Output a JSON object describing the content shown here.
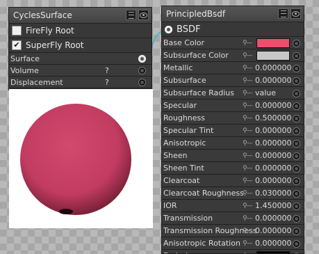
{
  "cycles_node": {
    "title": "CyclesSurface",
    "checks": [
      {
        "label": "FireFly Root",
        "checked": false
      },
      {
        "label": "SuperFly Root",
        "checked": true
      }
    ],
    "rows": [
      {
        "label": "Surface",
        "value": ""
      },
      {
        "label": "Volume",
        "value": "?"
      },
      {
        "label": "Displacement",
        "value": "?"
      }
    ]
  },
  "principled_node": {
    "title": "PrincipledBsdf",
    "output_label": "BSDF",
    "rows": [
      {
        "label": "Base Color",
        "type": "color",
        "value": "",
        "color": "#ee4d6d"
      },
      {
        "label": "Subsurface Color",
        "type": "color",
        "value": "",
        "color": "#c8c8c8"
      },
      {
        "label": "Metallic",
        "type": "number",
        "value": "0.000000"
      },
      {
        "label": "Subsurface",
        "type": "number",
        "value": "0.000000"
      },
      {
        "label": "Subsurface Radius",
        "type": "text",
        "value": "value"
      },
      {
        "label": "Specular",
        "type": "number",
        "value": "0.000000"
      },
      {
        "label": "Roughness",
        "type": "number",
        "value": "0.500000"
      },
      {
        "label": "Specular Tint",
        "type": "number",
        "value": "0.000000"
      },
      {
        "label": "Anisotropic",
        "type": "number",
        "value": "0.000000"
      },
      {
        "label": "Sheen",
        "type": "number",
        "value": "0.000000"
      },
      {
        "label": "Sheen Tint",
        "type": "number",
        "value": "0.000000"
      },
      {
        "label": "Clearcoat",
        "type": "number",
        "value": "0.000000"
      },
      {
        "label": "Clearcoat Roughness",
        "type": "number",
        "value": "0.030000"
      },
      {
        "label": "IOR",
        "type": "number",
        "value": "1.450000"
      },
      {
        "label": "Transmission",
        "type": "number",
        "value": "0.000000"
      },
      {
        "label": "Transmission Roughness",
        "type": "number",
        "value": "0.000000"
      },
      {
        "label": "Anisotropic Rotation",
        "type": "number",
        "value": "0.000000"
      },
      {
        "label": "Emission",
        "type": "color",
        "value": "",
        "color": "#000000"
      }
    ]
  },
  "colors": {
    "link_wire": "#4fb7c6",
    "sphere_base": "#c83f63",
    "sphere_shadow": "#7a2238"
  }
}
